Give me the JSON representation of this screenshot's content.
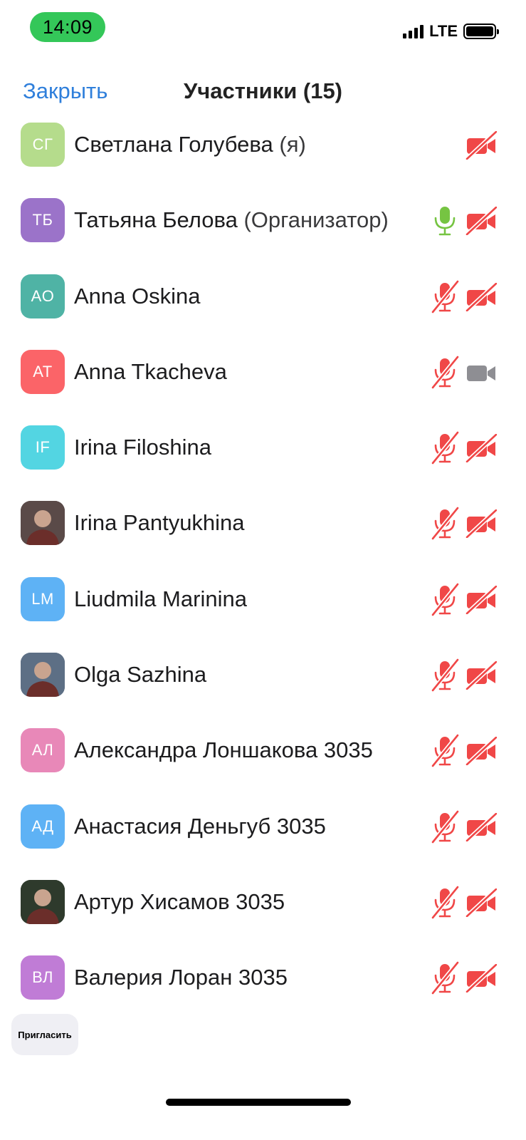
{
  "status_bar": {
    "time": "14:09",
    "network": "LTE"
  },
  "nav": {
    "close_label": "Закрыть",
    "title": "Участники (15)"
  },
  "colors": {
    "accent": "#2f7fdb",
    "muted_red": "#f04747",
    "mic_on": "#76c442",
    "video_off_gray": "#8e8e93"
  },
  "participants": [
    {
      "initials": "СГ",
      "name": "Светлана Голубева",
      "suffix": "(я)",
      "avatar_color": "#b5dc8c",
      "photo": false,
      "mic": "none",
      "cam": "off"
    },
    {
      "initials": "ТБ",
      "name": "Татьяна Белова",
      "suffix": "(Организатор)",
      "avatar_color": "#9b73c9",
      "photo": false,
      "mic": "on",
      "cam": "off"
    },
    {
      "initials": "AO",
      "name": "Anna Oskina",
      "suffix": "",
      "avatar_color": "#4fb3a5",
      "photo": false,
      "mic": "muted",
      "cam": "off"
    },
    {
      "initials": "AT",
      "name": "Anna Tkacheva",
      "suffix": "",
      "avatar_color": "#fb6468",
      "photo": false,
      "mic": "muted",
      "cam": "on"
    },
    {
      "initials": "IF",
      "name": "Irina Filoshina",
      "suffix": "",
      "avatar_color": "#53d5e2",
      "photo": false,
      "mic": "muted",
      "cam": "off"
    },
    {
      "initials": "",
      "name": "Irina Pantyukhina",
      "suffix": "",
      "avatar_color": "#5a4a48",
      "photo": true,
      "mic": "muted",
      "cam": "off"
    },
    {
      "initials": "LM",
      "name": "Liudmila Marinina",
      "suffix": "",
      "avatar_color": "#5eb2f5",
      "photo": false,
      "mic": "muted",
      "cam": "off"
    },
    {
      "initials": "",
      "name": "Olga Sazhina",
      "suffix": "",
      "avatar_color": "#5d6f85",
      "photo": true,
      "mic": "muted",
      "cam": "off"
    },
    {
      "initials": "АЛ",
      "name": "Александра Лоншакова 3035",
      "suffix": "",
      "avatar_color": "#e888b8",
      "photo": false,
      "mic": "muted",
      "cam": "off"
    },
    {
      "initials": "АД",
      "name": "Анастасия Деньгуб 3035",
      "suffix": "",
      "avatar_color": "#5eb2f5",
      "photo": false,
      "mic": "muted",
      "cam": "off"
    },
    {
      "initials": "",
      "name": "Артур Хисамов 3035",
      "suffix": "",
      "avatar_color": "#2e3a2c",
      "photo": true,
      "mic": "muted",
      "cam": "off"
    },
    {
      "initials": "ВЛ",
      "name": "Валерия Лоран 3035",
      "suffix": "",
      "avatar_color": "#c07cd6",
      "photo": false,
      "mic": "muted",
      "cam": "off"
    }
  ],
  "footer": {
    "invite_label": "Пригласить"
  }
}
